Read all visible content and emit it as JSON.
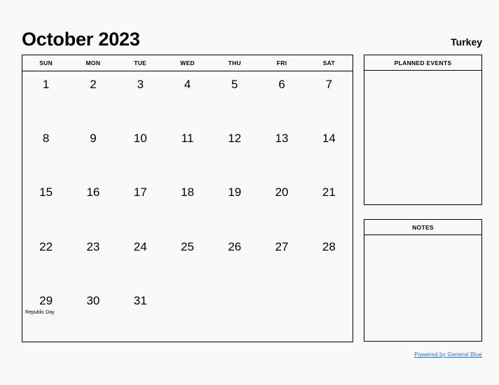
{
  "header": {
    "title": "October 2023",
    "country": "Turkey"
  },
  "calendar": {
    "weekdays": [
      "SUN",
      "MON",
      "TUE",
      "WED",
      "THU",
      "FRI",
      "SAT"
    ],
    "weeks": [
      [
        {
          "day": "1",
          "holiday": ""
        },
        {
          "day": "2",
          "holiday": ""
        },
        {
          "day": "3",
          "holiday": ""
        },
        {
          "day": "4",
          "holiday": ""
        },
        {
          "day": "5",
          "holiday": ""
        },
        {
          "day": "6",
          "holiday": ""
        },
        {
          "day": "7",
          "holiday": ""
        }
      ],
      [
        {
          "day": "8",
          "holiday": ""
        },
        {
          "day": "9",
          "holiday": ""
        },
        {
          "day": "10",
          "holiday": ""
        },
        {
          "day": "11",
          "holiday": ""
        },
        {
          "day": "12",
          "holiday": ""
        },
        {
          "day": "13",
          "holiday": ""
        },
        {
          "day": "14",
          "holiday": ""
        }
      ],
      [
        {
          "day": "15",
          "holiday": ""
        },
        {
          "day": "16",
          "holiday": ""
        },
        {
          "day": "17",
          "holiday": ""
        },
        {
          "day": "18",
          "holiday": ""
        },
        {
          "day": "19",
          "holiday": ""
        },
        {
          "day": "20",
          "holiday": ""
        },
        {
          "day": "21",
          "holiday": ""
        }
      ],
      [
        {
          "day": "22",
          "holiday": ""
        },
        {
          "day": "23",
          "holiday": ""
        },
        {
          "day": "24",
          "holiday": ""
        },
        {
          "day": "25",
          "holiday": ""
        },
        {
          "day": "26",
          "holiday": ""
        },
        {
          "day": "27",
          "holiday": ""
        },
        {
          "day": "28",
          "holiday": ""
        }
      ],
      [
        {
          "day": "29",
          "holiday": "Republic Day"
        },
        {
          "day": "30",
          "holiday": ""
        },
        {
          "day": "31",
          "holiday": ""
        },
        {
          "day": "",
          "holiday": ""
        },
        {
          "day": "",
          "holiday": ""
        },
        {
          "day": "",
          "holiday": ""
        },
        {
          "day": "",
          "holiday": ""
        }
      ]
    ]
  },
  "panels": {
    "planned_events_title": "PLANNED EVENTS",
    "notes_title": "NOTES"
  },
  "footer": {
    "link_text": "Powered by General Blue",
    "link_color": "#3b6fc4"
  }
}
